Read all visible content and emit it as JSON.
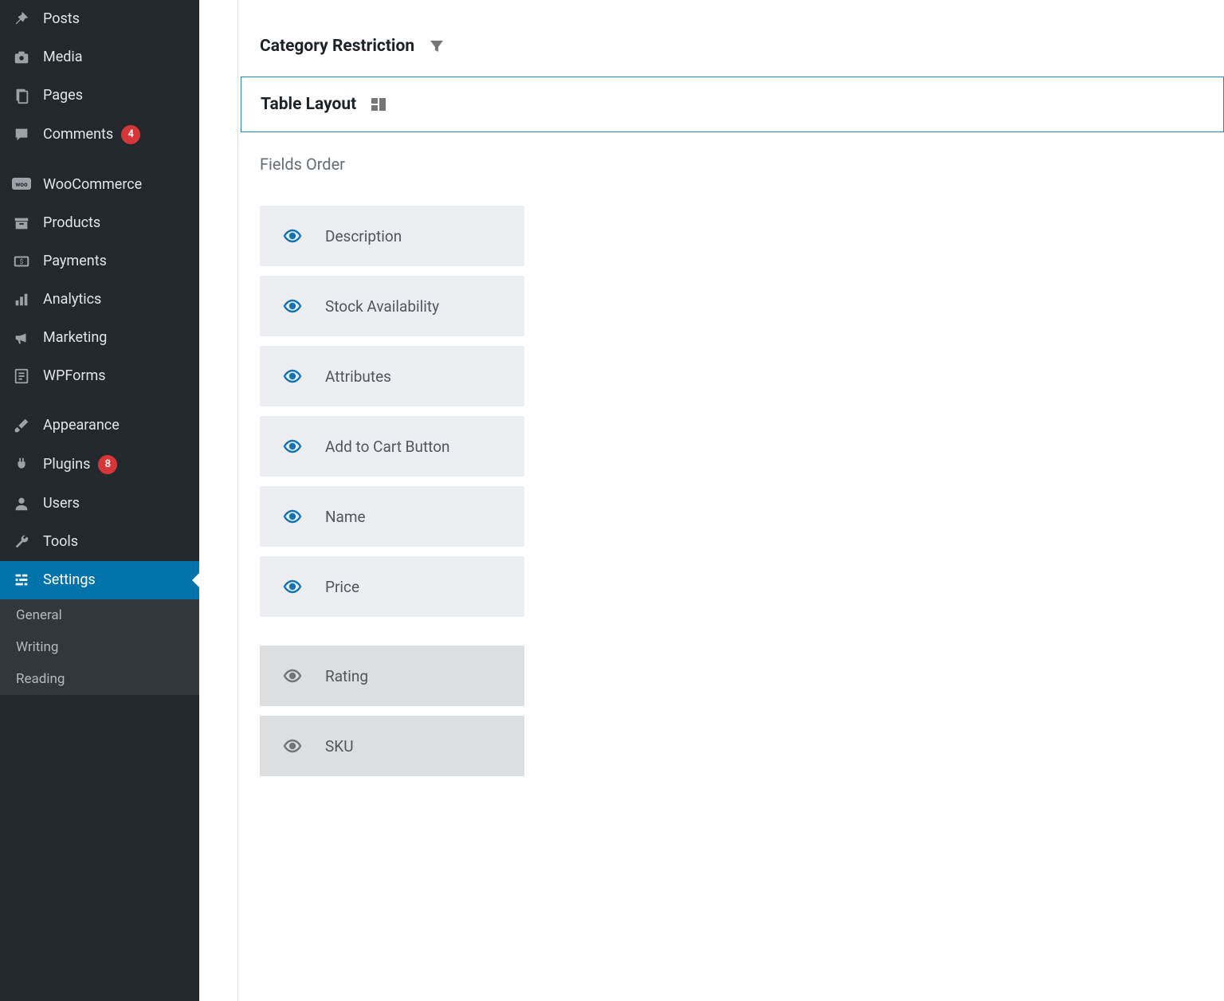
{
  "sidebar": {
    "items": [
      {
        "label": "Posts",
        "icon": "pin-icon",
        "badge": null
      },
      {
        "label": "Media",
        "icon": "camera-icon",
        "badge": null
      },
      {
        "label": "Pages",
        "icon": "pages-icon",
        "badge": null
      },
      {
        "label": "Comments",
        "icon": "comment-icon",
        "badge": "4"
      },
      {
        "label": "WooCommerce",
        "icon": "woo-icon",
        "badge": null
      },
      {
        "label": "Products",
        "icon": "archive-icon",
        "badge": null
      },
      {
        "label": "Payments",
        "icon": "payments-icon",
        "badge": null
      },
      {
        "label": "Analytics",
        "icon": "analytics-icon",
        "badge": null
      },
      {
        "label": "Marketing",
        "icon": "megaphone-icon",
        "badge": null
      },
      {
        "label": "WPForms",
        "icon": "wpforms-icon",
        "badge": null
      },
      {
        "label": "Appearance",
        "icon": "brush-icon",
        "badge": null
      },
      {
        "label": "Plugins",
        "icon": "plugin-icon",
        "badge": "8"
      },
      {
        "label": "Users",
        "icon": "users-icon",
        "badge": null
      },
      {
        "label": "Tools",
        "icon": "tools-icon",
        "badge": null
      },
      {
        "label": "Settings",
        "icon": "settings-icon",
        "badge": null,
        "active": true
      }
    ],
    "submenu": [
      {
        "label": "General"
      },
      {
        "label": "Writing"
      },
      {
        "label": "Reading"
      }
    ]
  },
  "main": {
    "category_restriction_label": "Category Restriction",
    "table_layout_label": "Table Layout",
    "fields_order_label": "Fields Order",
    "fields": [
      {
        "label": "Description",
        "visible": true
      },
      {
        "label": "Stock Availability",
        "visible": true
      },
      {
        "label": "Attributes",
        "visible": true
      },
      {
        "label": "Add to Cart Button",
        "visible": true
      },
      {
        "label": "Name",
        "visible": true
      },
      {
        "label": "Price",
        "visible": true
      },
      {
        "label": "Rating",
        "visible": false
      },
      {
        "label": "SKU",
        "visible": false
      }
    ]
  }
}
